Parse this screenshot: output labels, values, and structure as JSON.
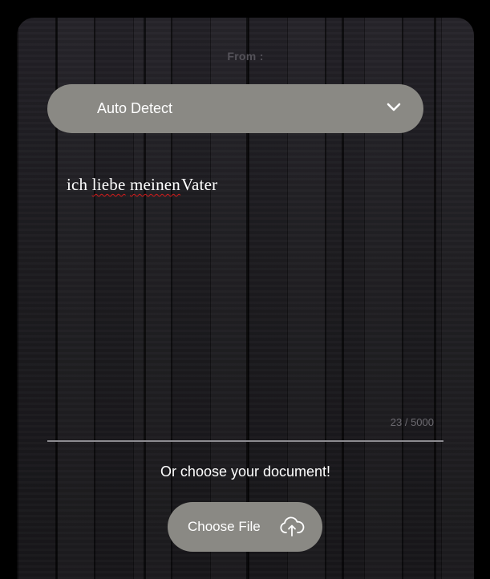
{
  "from_label": "From :",
  "language_select": {
    "value": "Auto Detect",
    "icon": "chevron-down-icon"
  },
  "source_text": {
    "words": [
      "ich",
      "liebe",
      "meinen",
      "Vater"
    ]
  },
  "char_counter": "23 / 5000",
  "document_prompt": "Or choose your document!",
  "choose_file": {
    "label": "Choose File",
    "icon": "cloud-upload-icon"
  },
  "colors": {
    "page_background": "#000000",
    "panel_wood": "#1e1d21",
    "pill_background": "#8a8984",
    "text_primary": "#ffffff",
    "text_muted": "#6c6a70",
    "spellcheck_underline": "#d11a1a"
  }
}
